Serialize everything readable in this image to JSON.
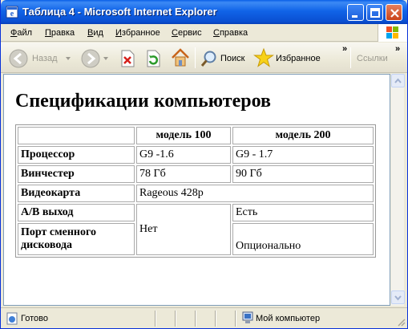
{
  "window": {
    "title": "Таблица 4 - Microsoft Internet Explorer"
  },
  "menu": {
    "items": [
      {
        "first": "Ф",
        "rest": "айл"
      },
      {
        "first": "П",
        "rest": "равка"
      },
      {
        "first": "В",
        "rest": "ид"
      },
      {
        "first": "И",
        "rest": "збранное"
      },
      {
        "first": "С",
        "rest": "ервис"
      },
      {
        "first": "С",
        "rest": "правка"
      }
    ]
  },
  "toolbar": {
    "back_label": "Назад",
    "search_label": "Поиск",
    "favorites_label": "Избранное",
    "links_label": "Ссылки",
    "chevron": "»"
  },
  "page": {
    "heading": "Спецификации компьютеров",
    "table": {
      "headers": [
        "",
        "модель 100",
        "модель 200"
      ],
      "rows": {
        "cpu": {
          "label": "Процессор",
          "m100": "G9 -1.6",
          "m200": "G9 - 1.7"
        },
        "hdd": {
          "label": "Винчестер",
          "m100": "78 Гб",
          "m200": "90 Гб"
        },
        "video": {
          "label": "Видеокарта",
          "both": "Rageous 428p"
        },
        "av": {
          "label": "A/B выход",
          "m100": "Нет",
          "m200": "Есть"
        },
        "floppy": {
          "label": "Порт сменного дисковода",
          "m200": "Опционально"
        }
      }
    }
  },
  "status": {
    "left": "Готово",
    "zone": "Мой компьютер"
  },
  "colors": {
    "titlebar": "#0a5fe6",
    "window_bg": "#ece9d8",
    "close_button": "#c9431a"
  }
}
